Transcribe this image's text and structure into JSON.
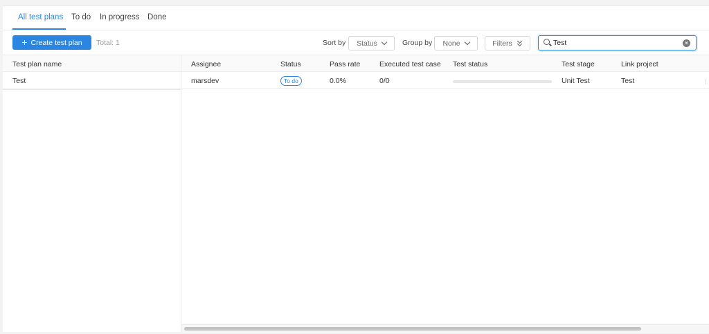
{
  "tabs": [
    {
      "label": "All test plans",
      "active": true
    },
    {
      "label": "To do",
      "active": false
    },
    {
      "label": "In progress",
      "active": false
    },
    {
      "label": "Done",
      "active": false
    }
  ],
  "toolbar": {
    "create_icon": "plus-icon",
    "create_label": "Create test plan",
    "total_label": "Total: 1",
    "sort_label": "Sort by",
    "sort_value": "Status",
    "group_label": "Group by",
    "group_value": "None",
    "filters_label": "Filters",
    "search_value": "Test",
    "search_icon": "search-icon",
    "clear_icon": "clear-icon"
  },
  "table": {
    "fixed_column": "Test plan name",
    "columns": [
      "Assignee",
      "Status",
      "Pass rate",
      "Executed test case",
      "Test status",
      "Test stage",
      "Link project"
    ],
    "rows": [
      {
        "name": "Test",
        "assignee": "marsdev",
        "status": "To do",
        "pass_rate": "0.0%",
        "executed": "0/0",
        "test_status_progress": 0,
        "test_stage": "Unit Test",
        "link_project": "Test"
      }
    ]
  },
  "colors": {
    "accent": "#2a86e0",
    "border": "#e8e8e8"
  }
}
